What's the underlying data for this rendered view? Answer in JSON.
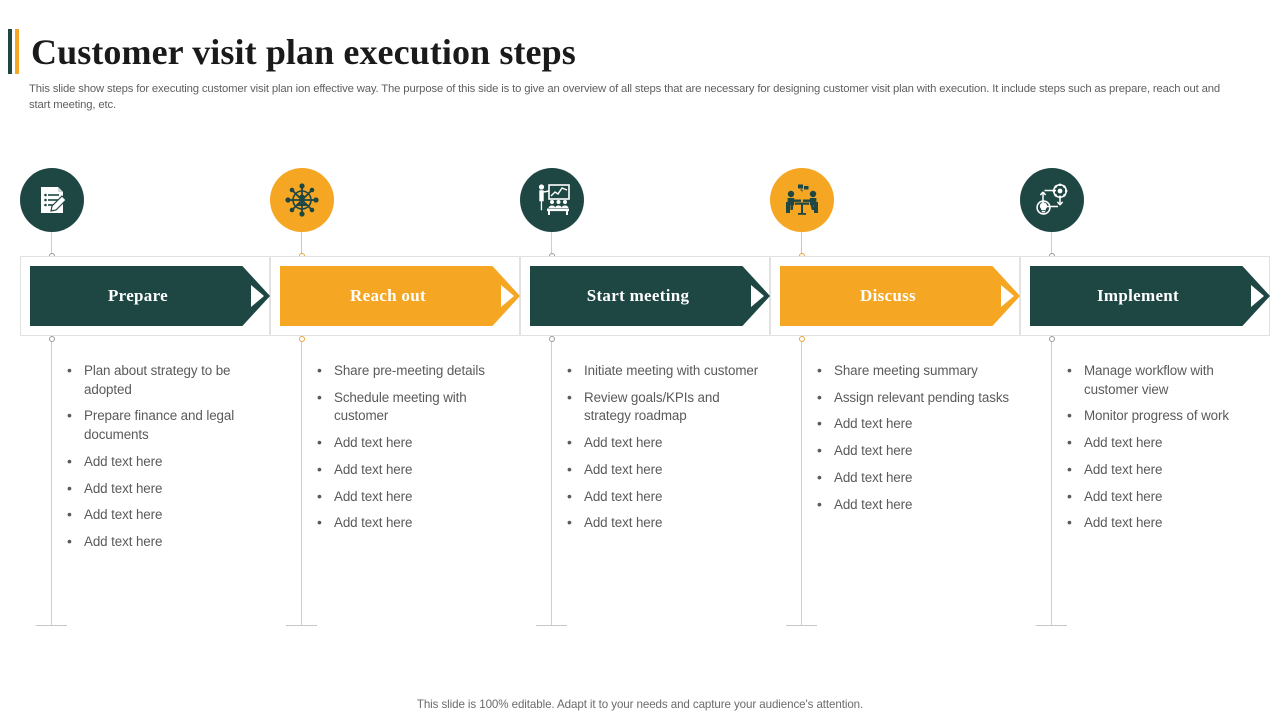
{
  "header": {
    "title": "Customer visit plan execution steps",
    "subtitle": "This slide show steps for executing customer visit plan ion effective way.  The purpose of this side is to give an overview of all steps that are necessary for designing customer visit plan with execution. It include steps such as prepare, reach out and start meeting, etc.",
    "accent_teal": "#1e4744",
    "accent_amber": "#f5a623"
  },
  "steps": [
    {
      "label": "Prepare",
      "color": "#1e4744",
      "theme": "dark",
      "icon": "document-pen-icon",
      "bullets": [
        "Plan about strategy to be adopted",
        "Prepare finance and legal documents",
        "Add text here",
        "Add text here",
        "Add text here",
        "Add text here"
      ]
    },
    {
      "label": "Reach out",
      "color": "#f5a623",
      "theme": "amber",
      "icon": "network-hub-person-icon",
      "bullets": [
        "Share pre-meeting details",
        "Schedule meeting with customer",
        "Add text here",
        "Add text here",
        "Add text here",
        "Add text here"
      ]
    },
    {
      "label": "Start meeting",
      "color": "#1e4744",
      "theme": "dark",
      "icon": "presentation-audience-icon",
      "bullets": [
        "Initiate meeting with customer",
        "Review goals/KPIs and strategy roadmap",
        "Add text here",
        "Add text here",
        "Add text here",
        "Add text here"
      ]
    },
    {
      "label": "Discuss",
      "color": "#f5a623",
      "theme": "amber",
      "icon": "two-people-table-discussion-icon",
      "bullets": [
        "Share meeting summary",
        "Assign relevant pending tasks",
        "Add text here",
        "Add text here",
        "Add text here",
        "Add text here"
      ]
    },
    {
      "label": "Implement",
      "color": "#1e4744",
      "theme": "dark",
      "icon": "gear-bulb-workflow-icon",
      "bullets": [
        "Manage workflow with customer view",
        "Monitor progress of work",
        "Add text here",
        "Add text here",
        "Add text here",
        "Add text here"
      ]
    }
  ],
  "footer": {
    "note": "This slide is 100% editable. Adapt it to your needs and capture your audience's attention."
  }
}
